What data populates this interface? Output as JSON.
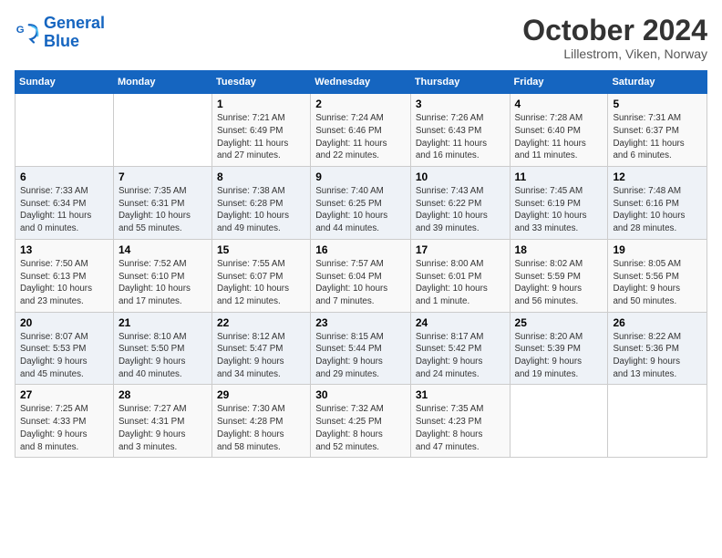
{
  "logo": {
    "line1": "General",
    "line2": "Blue"
  },
  "title": "October 2024",
  "location": "Lillestrom, Viken, Norway",
  "days_header": [
    "Sunday",
    "Monday",
    "Tuesday",
    "Wednesday",
    "Thursday",
    "Friday",
    "Saturday"
  ],
  "weeks": [
    [
      {
        "num": "",
        "info": ""
      },
      {
        "num": "",
        "info": ""
      },
      {
        "num": "1",
        "info": "Sunrise: 7:21 AM\nSunset: 6:49 PM\nDaylight: 11 hours\nand 27 minutes."
      },
      {
        "num": "2",
        "info": "Sunrise: 7:24 AM\nSunset: 6:46 PM\nDaylight: 11 hours\nand 22 minutes."
      },
      {
        "num": "3",
        "info": "Sunrise: 7:26 AM\nSunset: 6:43 PM\nDaylight: 11 hours\nand 16 minutes."
      },
      {
        "num": "4",
        "info": "Sunrise: 7:28 AM\nSunset: 6:40 PM\nDaylight: 11 hours\nand 11 minutes."
      },
      {
        "num": "5",
        "info": "Sunrise: 7:31 AM\nSunset: 6:37 PM\nDaylight: 11 hours\nand 6 minutes."
      }
    ],
    [
      {
        "num": "6",
        "info": "Sunrise: 7:33 AM\nSunset: 6:34 PM\nDaylight: 11 hours\nand 0 minutes."
      },
      {
        "num": "7",
        "info": "Sunrise: 7:35 AM\nSunset: 6:31 PM\nDaylight: 10 hours\nand 55 minutes."
      },
      {
        "num": "8",
        "info": "Sunrise: 7:38 AM\nSunset: 6:28 PM\nDaylight: 10 hours\nand 49 minutes."
      },
      {
        "num": "9",
        "info": "Sunrise: 7:40 AM\nSunset: 6:25 PM\nDaylight: 10 hours\nand 44 minutes."
      },
      {
        "num": "10",
        "info": "Sunrise: 7:43 AM\nSunset: 6:22 PM\nDaylight: 10 hours\nand 39 minutes."
      },
      {
        "num": "11",
        "info": "Sunrise: 7:45 AM\nSunset: 6:19 PM\nDaylight: 10 hours\nand 33 minutes."
      },
      {
        "num": "12",
        "info": "Sunrise: 7:48 AM\nSunset: 6:16 PM\nDaylight: 10 hours\nand 28 minutes."
      }
    ],
    [
      {
        "num": "13",
        "info": "Sunrise: 7:50 AM\nSunset: 6:13 PM\nDaylight: 10 hours\nand 23 minutes."
      },
      {
        "num": "14",
        "info": "Sunrise: 7:52 AM\nSunset: 6:10 PM\nDaylight: 10 hours\nand 17 minutes."
      },
      {
        "num": "15",
        "info": "Sunrise: 7:55 AM\nSunset: 6:07 PM\nDaylight: 10 hours\nand 12 minutes."
      },
      {
        "num": "16",
        "info": "Sunrise: 7:57 AM\nSunset: 6:04 PM\nDaylight: 10 hours\nand 7 minutes."
      },
      {
        "num": "17",
        "info": "Sunrise: 8:00 AM\nSunset: 6:01 PM\nDaylight: 10 hours\nand 1 minute."
      },
      {
        "num": "18",
        "info": "Sunrise: 8:02 AM\nSunset: 5:59 PM\nDaylight: 9 hours\nand 56 minutes."
      },
      {
        "num": "19",
        "info": "Sunrise: 8:05 AM\nSunset: 5:56 PM\nDaylight: 9 hours\nand 50 minutes."
      }
    ],
    [
      {
        "num": "20",
        "info": "Sunrise: 8:07 AM\nSunset: 5:53 PM\nDaylight: 9 hours\nand 45 minutes."
      },
      {
        "num": "21",
        "info": "Sunrise: 8:10 AM\nSunset: 5:50 PM\nDaylight: 9 hours\nand 40 minutes."
      },
      {
        "num": "22",
        "info": "Sunrise: 8:12 AM\nSunset: 5:47 PM\nDaylight: 9 hours\nand 34 minutes."
      },
      {
        "num": "23",
        "info": "Sunrise: 8:15 AM\nSunset: 5:44 PM\nDaylight: 9 hours\nand 29 minutes."
      },
      {
        "num": "24",
        "info": "Sunrise: 8:17 AM\nSunset: 5:42 PM\nDaylight: 9 hours\nand 24 minutes."
      },
      {
        "num": "25",
        "info": "Sunrise: 8:20 AM\nSunset: 5:39 PM\nDaylight: 9 hours\nand 19 minutes."
      },
      {
        "num": "26",
        "info": "Sunrise: 8:22 AM\nSunset: 5:36 PM\nDaylight: 9 hours\nand 13 minutes."
      }
    ],
    [
      {
        "num": "27",
        "info": "Sunrise: 7:25 AM\nSunset: 4:33 PM\nDaylight: 9 hours\nand 8 minutes."
      },
      {
        "num": "28",
        "info": "Sunrise: 7:27 AM\nSunset: 4:31 PM\nDaylight: 9 hours\nand 3 minutes."
      },
      {
        "num": "29",
        "info": "Sunrise: 7:30 AM\nSunset: 4:28 PM\nDaylight: 8 hours\nand 58 minutes."
      },
      {
        "num": "30",
        "info": "Sunrise: 7:32 AM\nSunset: 4:25 PM\nDaylight: 8 hours\nand 52 minutes."
      },
      {
        "num": "31",
        "info": "Sunrise: 7:35 AM\nSunset: 4:23 PM\nDaylight: 8 hours\nand 47 minutes."
      },
      {
        "num": "",
        "info": ""
      },
      {
        "num": "",
        "info": ""
      }
    ]
  ]
}
